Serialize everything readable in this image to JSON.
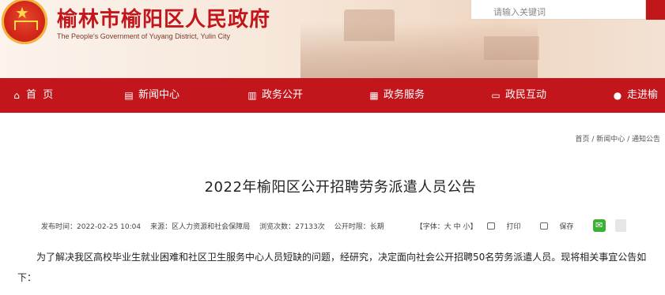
{
  "header": {
    "title": "榆林市榆阳区人民政府",
    "subtitle": "The People's Government of Yuyang District, Yulin City",
    "search_placeholder": "请输入关键词",
    "brand_color": "#c3161c"
  },
  "nav": {
    "items": [
      {
        "label": "首  页",
        "icon": "home-icon"
      },
      {
        "label": "新闻中心",
        "icon": "news-icon"
      },
      {
        "label": "政务公开",
        "icon": "book-icon"
      },
      {
        "label": "政务服务",
        "icon": "service-icon"
      },
      {
        "label": "政民互动",
        "icon": "chat-icon"
      },
      {
        "label": "走进榆",
        "icon": "location-icon"
      }
    ]
  },
  "breadcrumb": "首页 / 新闻中心 / 通知公告",
  "article": {
    "title": "2022年榆阳区公开招聘劳务派遣人员公告",
    "publish_time": "发布时间：2022-02-25 10:04",
    "source": "来源：区人力资源和社会保障局",
    "views": "浏览次数：27133次",
    "validity": "公开时限：长期",
    "font_size": "【字体：大 中 小】",
    "print": "打印",
    "save": "保存",
    "body": "为了解决我区高校毕业生就业困难和社区卫生服务中心人员短缺的问题，经研究，决定面向社会公开招聘50名劳务派遣人员。现将相关事宜公告如下："
  }
}
